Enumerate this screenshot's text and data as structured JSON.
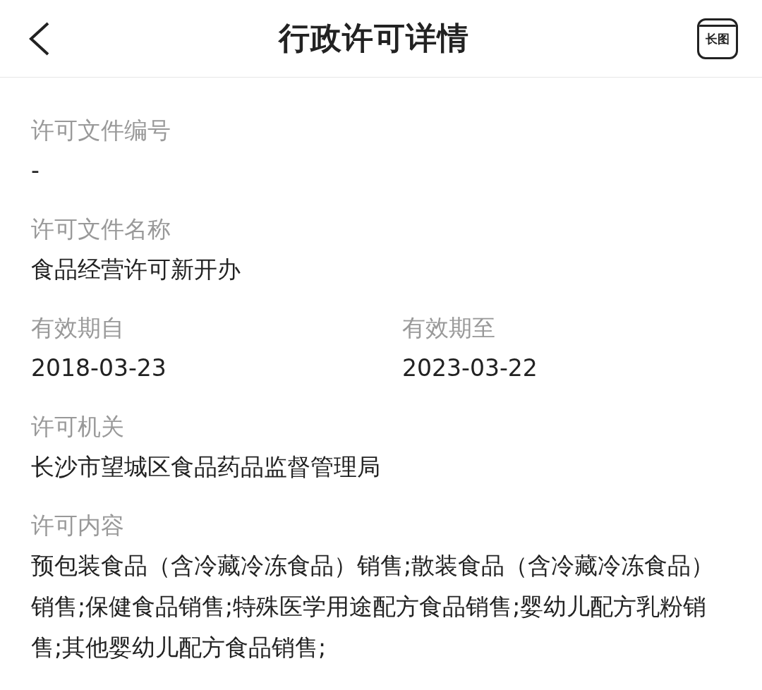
{
  "header": {
    "title": "行政许可详情",
    "long_image_icon": "长图"
  },
  "fields": [
    {
      "kind": "single",
      "label": "许可文件编号",
      "value": "-"
    },
    {
      "kind": "single",
      "label": "许可文件名称",
      "value": "食品经营许可新开办"
    },
    {
      "kind": "pair",
      "items": [
        {
          "label": "有效期自",
          "value": "2018-03-23"
        },
        {
          "label": "有效期至",
          "value": "2023-03-22"
        }
      ]
    },
    {
      "kind": "single",
      "label": "许可机关",
      "value": "长沙市望城区食品药品监督管理局"
    },
    {
      "kind": "single",
      "label": "许可内容",
      "value": "预包装食品（含冷藏冷冻食品）销售;散装食品（含冷藏冷冻食品）销售;保健食品销售;特殊医学用途配方食品销售;婴幼儿配方乳粉销售;其他婴幼儿配方食品销售;"
    }
  ]
}
